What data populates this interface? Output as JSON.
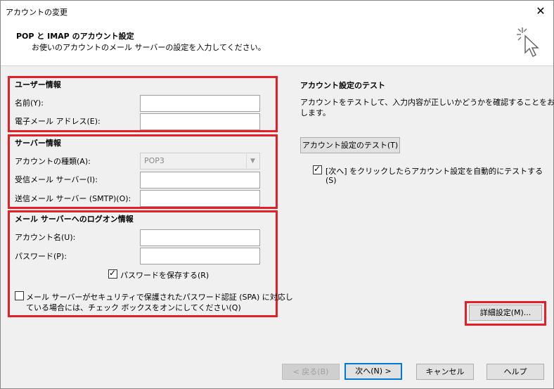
{
  "window": {
    "title": "アカウントの変更"
  },
  "header": {
    "title": "POP と IMAP のアカウント設定",
    "subtitle": "お使いのアカウントのメール サーバーの設定を入力してください。"
  },
  "user_info": {
    "title": "ユーザー情報",
    "name_label": "名前(Y):",
    "email_label": "電子メール アドレス(E):",
    "name_value": "",
    "email_value": ""
  },
  "server_info": {
    "title": "サーバー情報",
    "account_type_label": "アカウントの種類(A):",
    "account_type_value": "POP3",
    "incoming_label": "受信メール サーバー(I):",
    "outgoing_label": "送信メール サーバー (SMTP)(O):",
    "incoming_value": "",
    "outgoing_value": ""
  },
  "logon_info": {
    "title": "メール サーバーへのログオン情報",
    "account_name_label": "アカウント名(U):",
    "password_label": "パスワード(P):",
    "account_name_value": "",
    "password_value": "",
    "remember_password_label": "パスワードを保存する(R)",
    "remember_password_checked": true,
    "spa_line1": "メール サーバーがセキュリティで保護されたパスワード認証 (SPA) に対応し",
    "spa_line2": "ている場合には、チェック ボックスをオンにしてください(Q)",
    "spa_checked": false
  },
  "test_panel": {
    "title": "アカウント設定のテスト",
    "desc_line1": "アカウントをテストして、入力内容が正しいかどうかを確認することをお勧め",
    "desc_line2": "します。",
    "test_button": "アカウント設定のテスト(T)",
    "auto_test_line1": "[次へ] をクリックしたらアカウント設定を自動的にテストする",
    "auto_test_line2": "(S)",
    "auto_test_checked": true,
    "more_settings_button": "詳細設定(M)..."
  },
  "footer": {
    "back_button": "< 戻る(B)",
    "next_button": "次へ(N) >",
    "cancel_button": "キャンセル",
    "help_button": "ヘルプ"
  },
  "colors": {
    "highlight": "#e32027",
    "default_button_border": "#0078d7"
  }
}
